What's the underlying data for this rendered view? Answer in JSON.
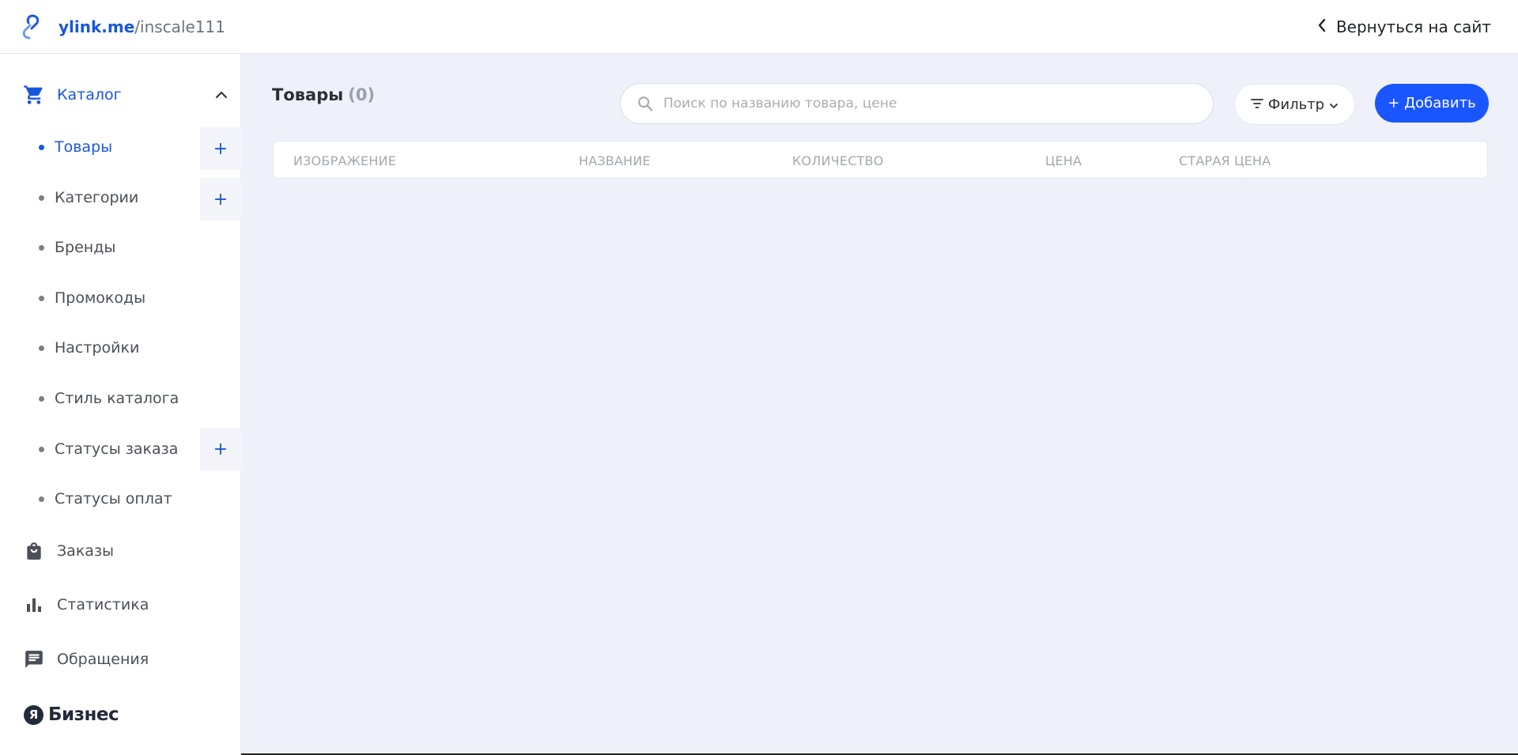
{
  "header": {
    "brand_domain": "ylink.me",
    "brand_path": "/inscale111",
    "back_link": "Вернуться на сайт"
  },
  "sidebar": {
    "catalog": {
      "label": "Каталог",
      "icon": "cart-icon",
      "expanded": true
    },
    "sub_items": [
      {
        "label": "Товары",
        "active": true,
        "has_add": true
      },
      {
        "label": "Категории",
        "active": false,
        "has_add": true
      },
      {
        "label": "Бренды",
        "active": false,
        "has_add": false
      },
      {
        "label": "Промокоды",
        "active": false,
        "has_add": false
      },
      {
        "label": "Настройки",
        "active": false,
        "has_add": false
      },
      {
        "label": "Стиль каталога",
        "active": false,
        "has_add": false
      },
      {
        "label": "Статусы заказа",
        "active": false,
        "has_add": true
      },
      {
        "label": "Статусы оплат",
        "active": false,
        "has_add": false
      }
    ],
    "sections": [
      {
        "label": "Заказы",
        "icon": "shopping-bag-icon"
      },
      {
        "label": "Статистика",
        "icon": "bar-chart-icon"
      },
      {
        "label": "Обращения",
        "icon": "message-icon"
      }
    ],
    "footer": {
      "logo_letter": "Я",
      "logo_text": "Бизнес"
    }
  },
  "main": {
    "title": "Товары",
    "count": "(0)",
    "search_placeholder": "Поиск по названию товара, цене",
    "search_value": "",
    "filter_label": "Фильтр",
    "add_label": "+ Добавить",
    "columns": [
      "ИЗОБРАЖЕНИЕ",
      "НАЗВАНИЕ",
      "КОЛИЧЕСТВО",
      "ЦЕНА",
      "СТАРАЯ ЦЕНА"
    ]
  },
  "colors": {
    "accent": "#1a56db",
    "button": "#1a56ff",
    "background": "#eef1fa"
  }
}
